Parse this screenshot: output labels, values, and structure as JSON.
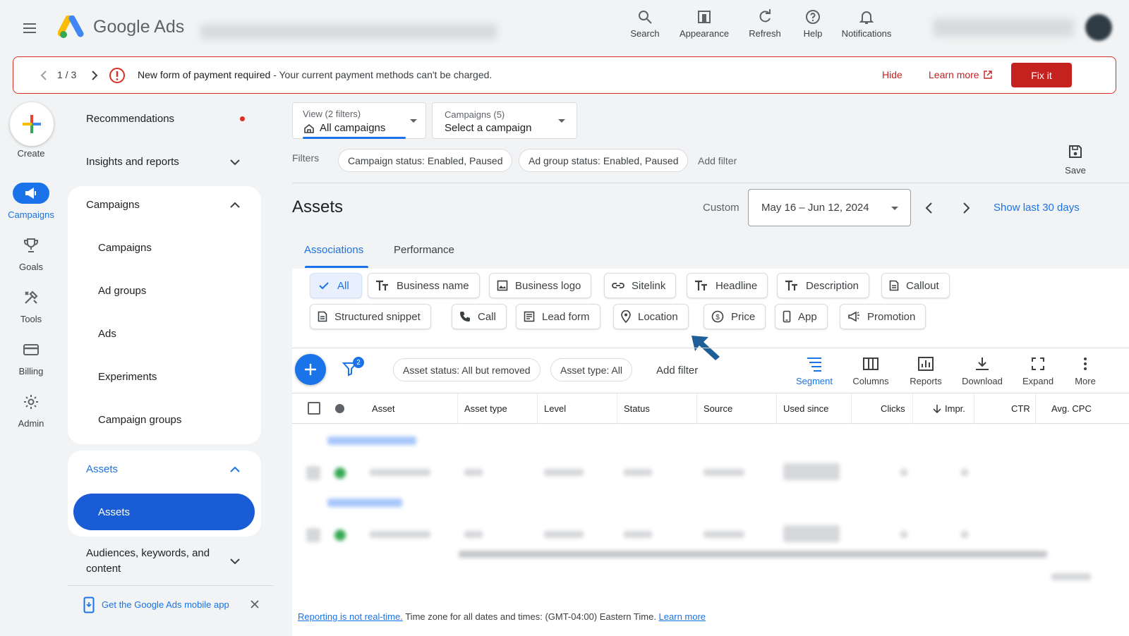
{
  "header": {
    "brand": "Google Ads",
    "actions": [
      {
        "label": "Search",
        "icon": "search-icon"
      },
      {
        "label": "Appearance",
        "icon": "appearance-icon"
      },
      {
        "label": "Refresh",
        "icon": "refresh-icon"
      },
      {
        "label": "Help",
        "icon": "help-icon"
      },
      {
        "label": "Notifications",
        "icon": "bell-icon"
      }
    ]
  },
  "alert": {
    "counter": "1 / 3",
    "title": "New form of payment required",
    "message": " - Your current payment methods can't be charged.",
    "hide": "Hide",
    "learn_more": "Learn more",
    "fix": "Fix it"
  },
  "rail": {
    "create": "Create",
    "items": [
      {
        "label": "Campaigns",
        "icon": "megaphone-icon",
        "active": true
      },
      {
        "label": "Goals",
        "icon": "trophy-icon"
      },
      {
        "label": "Tools",
        "icon": "tools-icon"
      },
      {
        "label": "Billing",
        "icon": "credit-card-icon"
      },
      {
        "label": "Admin",
        "icon": "gear-icon"
      }
    ]
  },
  "sidenav": {
    "recommendations": "Recommendations",
    "insights": "Insights and reports",
    "campaigns_section": "Campaigns",
    "campaigns_children": [
      "Campaigns",
      "Ad groups",
      "Ads",
      "Experiments",
      "Campaign groups"
    ],
    "assets_section": "Assets",
    "assets_child": "Assets",
    "audiences_line1": "Audiences, keywords, and",
    "audiences_line2": "content",
    "mobile_app": "Get the Google Ads mobile app"
  },
  "filters_bar": {
    "view_small": "View (2 filters)",
    "view_value": "All campaigns",
    "campaign_small": "Campaigns (5)",
    "campaign_value": "Select a campaign",
    "filters_label": "Filters",
    "chips": [
      "Campaign status: Enabled, Paused",
      "Ad group status: Enabled, Paused"
    ],
    "add_filter": "Add filter",
    "save": "Save"
  },
  "page": {
    "title": "Assets",
    "date_preset": "Custom",
    "date_range": "May 16 – Jun 12, 2024",
    "show_last": "Show last 30 days",
    "tabs": [
      "Associations",
      "Performance"
    ]
  },
  "asset_types": {
    "row1": [
      "All",
      "Business name",
      "Business logo",
      "Sitelink",
      "Headline",
      "Description",
      "Callout"
    ],
    "row2": [
      "Structured snippet",
      "Call",
      "Lead form",
      "Location",
      "Price",
      "App",
      "Promotion"
    ]
  },
  "table_toolbar": {
    "filter_count": "2",
    "chips": [
      "Asset status: All but removed",
      "Asset type: All"
    ],
    "add_filter": "Add filter",
    "actions": [
      "Segment",
      "Columns",
      "Reports",
      "Download",
      "Expand",
      "More"
    ]
  },
  "table": {
    "columns": [
      "Asset",
      "Asset type",
      "Level",
      "Status",
      "Source",
      "Used since",
      "Clicks",
      "Impr.",
      "CTR",
      "Avg. CPC"
    ]
  },
  "footer": {
    "link1": "Reporting is not real-time.",
    "text": " Time zone for all dates and times: (GMT-04:00) Eastern Time. ",
    "link2": "Learn more"
  },
  "colors": {
    "accent": "#1a73e8",
    "alert": "#c5221f",
    "nav_active": "#1a5bd6"
  }
}
